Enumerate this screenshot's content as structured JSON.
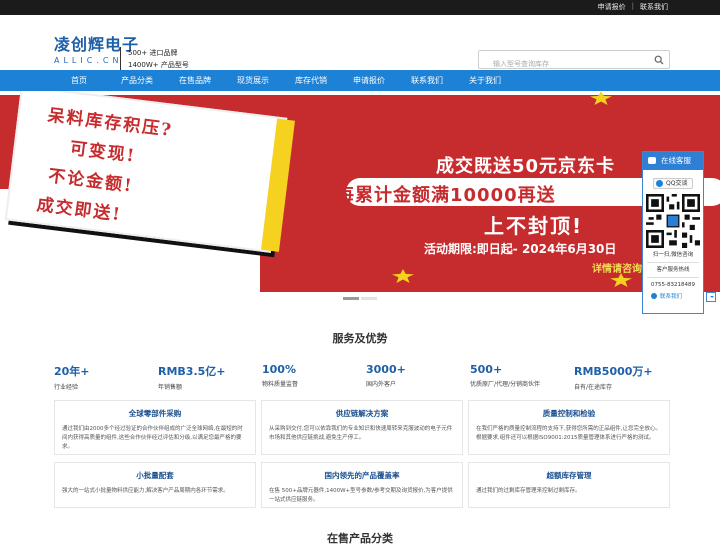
{
  "topbar": {
    "quote_link": "申请报价",
    "contact_link": "联系我们"
  },
  "logo": {
    "cn": "凌创辉电子",
    "en": "ALLIC.CN"
  },
  "tagline": {
    "line1": "500+ 进口品牌",
    "line2": "1400W+ 产品型号"
  },
  "search": {
    "placeholder": "输入型号查询库存"
  },
  "nav": {
    "items": [
      "首页",
      "产品分类",
      "在售品牌",
      "现货展示",
      "库存代销",
      "申请报价",
      "联系我们",
      "关于我们"
    ]
  },
  "banner": {
    "poster_lines": [
      "呆料库存积压?",
      "可变现!",
      "不论金额!",
      "成交即送!"
    ],
    "promo_line1": "成交既送50元京东卡",
    "promo_line2": "每累计金额满10000再送",
    "promo_line3": "上不封顶!",
    "promo_line4": "活动期限:即日起- 2024年6月30日",
    "promo_line5": "详情请咨询"
  },
  "services": {
    "title": "服务及优势",
    "stats": [
      {
        "num": "20年+",
        "label": "行业经验"
      },
      {
        "num": "RMB3.5亿+",
        "label": "年销售额"
      },
      {
        "num": "100%",
        "label": "物料质量监督"
      },
      {
        "num": "3000+",
        "label": "国内外客户"
      },
      {
        "num": "500+",
        "label": "优质原厂/代理/分销商伙伴"
      },
      {
        "num": "RMB5000万+",
        "label": "自有/在途库存"
      }
    ],
    "cards": [
      {
        "title": "全球零部件采购",
        "desc": "通过我们由2000多个经过验证的合作伙伴组成的广泛全球网络,在最短的时间内获得高质量的组件,这些合作伙伴经过评估和分级,以满足您最严格的要求。"
      },
      {
        "title": "供应链解决方案",
        "desc": "从采购到交付,您可以依靠我们的专业知识和快速周转来克服波动的电子元件市场和其他供应链挑战,避免生产停工。"
      },
      {
        "title": "质量控制和检验",
        "desc": "在我们严格的质量控制流程的支持下,获得您所需的正品组件,让您完全放心。根据要求,组件还可以根据ISO9001:2015质量管理体系进行严格的测试。"
      },
      {
        "title": "小批量配套",
        "desc": "强大的一站式小批量物料供应能力,解决客户产品周期内各环节需求。"
      },
      {
        "title": "国内领先的产品覆盖率",
        "desc": "在售 500+品牌元器件,1400W+型号参数/参考交期及询货报价,为客户提供一站式供应链服务。"
      },
      {
        "title": "超额库存管理",
        "desc": "通过我们的过剩库存管理来控制过剩库存。"
      }
    ]
  },
  "products": {
    "title": "在售产品分类"
  },
  "sidebar": {
    "title": "在线客服",
    "qq_label": "QQ交谈",
    "qr_caption_1": "扫一扫,微信咨询",
    "hotline_label": "客户服务热线",
    "hotline": "0755-83218489",
    "contact_label": "联系我们"
  }
}
